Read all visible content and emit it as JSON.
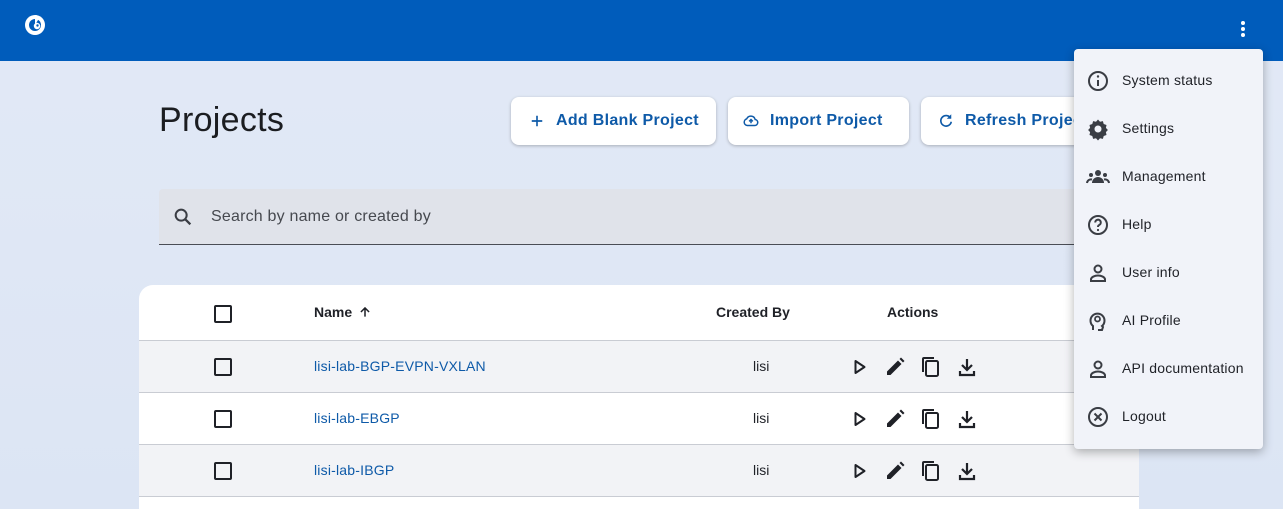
{
  "header": {
    "logo_icon": "gnome-logo-icon",
    "menu_icon": "more-vert-icon",
    "bg_color": "#005cbb"
  },
  "page": {
    "title": "Projects"
  },
  "toolbar": {
    "add_label": "Add Blank Project",
    "import_label": "Import Project",
    "refresh_label": "Refresh Projects"
  },
  "search": {
    "placeholder": "Search by name or created by",
    "value": ""
  },
  "table": {
    "columns": {
      "name": "Name",
      "created_by": "Created By",
      "actions": "Actions"
    },
    "rows": [
      {
        "name": "lisi-lab-BGP-EVPN-VXLAN",
        "created_by": "lisi"
      },
      {
        "name": "lisi-lab-EBGP",
        "created_by": "lisi"
      },
      {
        "name": "lisi-lab-IBGP",
        "created_by": "lisi"
      }
    ]
  },
  "menu": {
    "items": [
      {
        "label": "System status",
        "icon": "info-icon"
      },
      {
        "label": "Settings",
        "icon": "gear-icon"
      },
      {
        "label": "Management",
        "icon": "group-icon"
      },
      {
        "label": "Help",
        "icon": "help-icon"
      },
      {
        "label": "User info",
        "icon": "person-icon"
      },
      {
        "label": "AI Profile",
        "icon": "ai-head-icon"
      },
      {
        "label": "API documentation",
        "icon": "person-icon"
      },
      {
        "label": "Logout",
        "icon": "cancel-icon"
      }
    ]
  }
}
